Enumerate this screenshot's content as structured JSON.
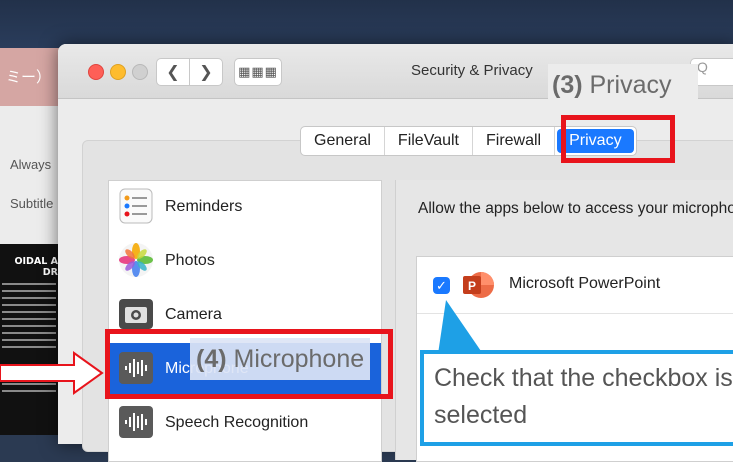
{
  "background": {
    "window_title": "ミー）",
    "labels": [
      "Always",
      "Subtitle"
    ],
    "doc_title_lines": [
      "OIDAL A",
      "DR"
    ]
  },
  "window": {
    "title": "Security & Privacy",
    "search_placeholder": "Q"
  },
  "tabs": [
    {
      "label": "General"
    },
    {
      "label": "FileVault"
    },
    {
      "label": "Firewall"
    },
    {
      "label": "Privacy",
      "active": true
    }
  ],
  "sidebar": {
    "items": [
      {
        "label": "Reminders",
        "icon": "reminders-icon"
      },
      {
        "label": "Photos",
        "icon": "photos-icon"
      },
      {
        "label": "Camera",
        "icon": "camera-icon"
      },
      {
        "label": "Microphone",
        "icon": "microphone-icon",
        "selected": true
      },
      {
        "label": "Speech Recognition",
        "icon": "speech-recognition-icon"
      }
    ]
  },
  "right_panel": {
    "description": "Allow the apps below to access your microphone.",
    "apps": [
      {
        "name": "Microsoft PowerPoint",
        "checked": true
      }
    ]
  },
  "annotations": {
    "privacy_step": {
      "number": "(3)",
      "text": " Privacy"
    },
    "microphone_step": {
      "number": "(4)",
      "text": " Microphone"
    },
    "callout": "Check that the checkbox is selected"
  },
  "colors": {
    "highlight_red": "#e8141c",
    "callout_blue": "#1ea0e6",
    "selection_blue": "#1a63db",
    "accent_blue": "#1a79ff"
  }
}
